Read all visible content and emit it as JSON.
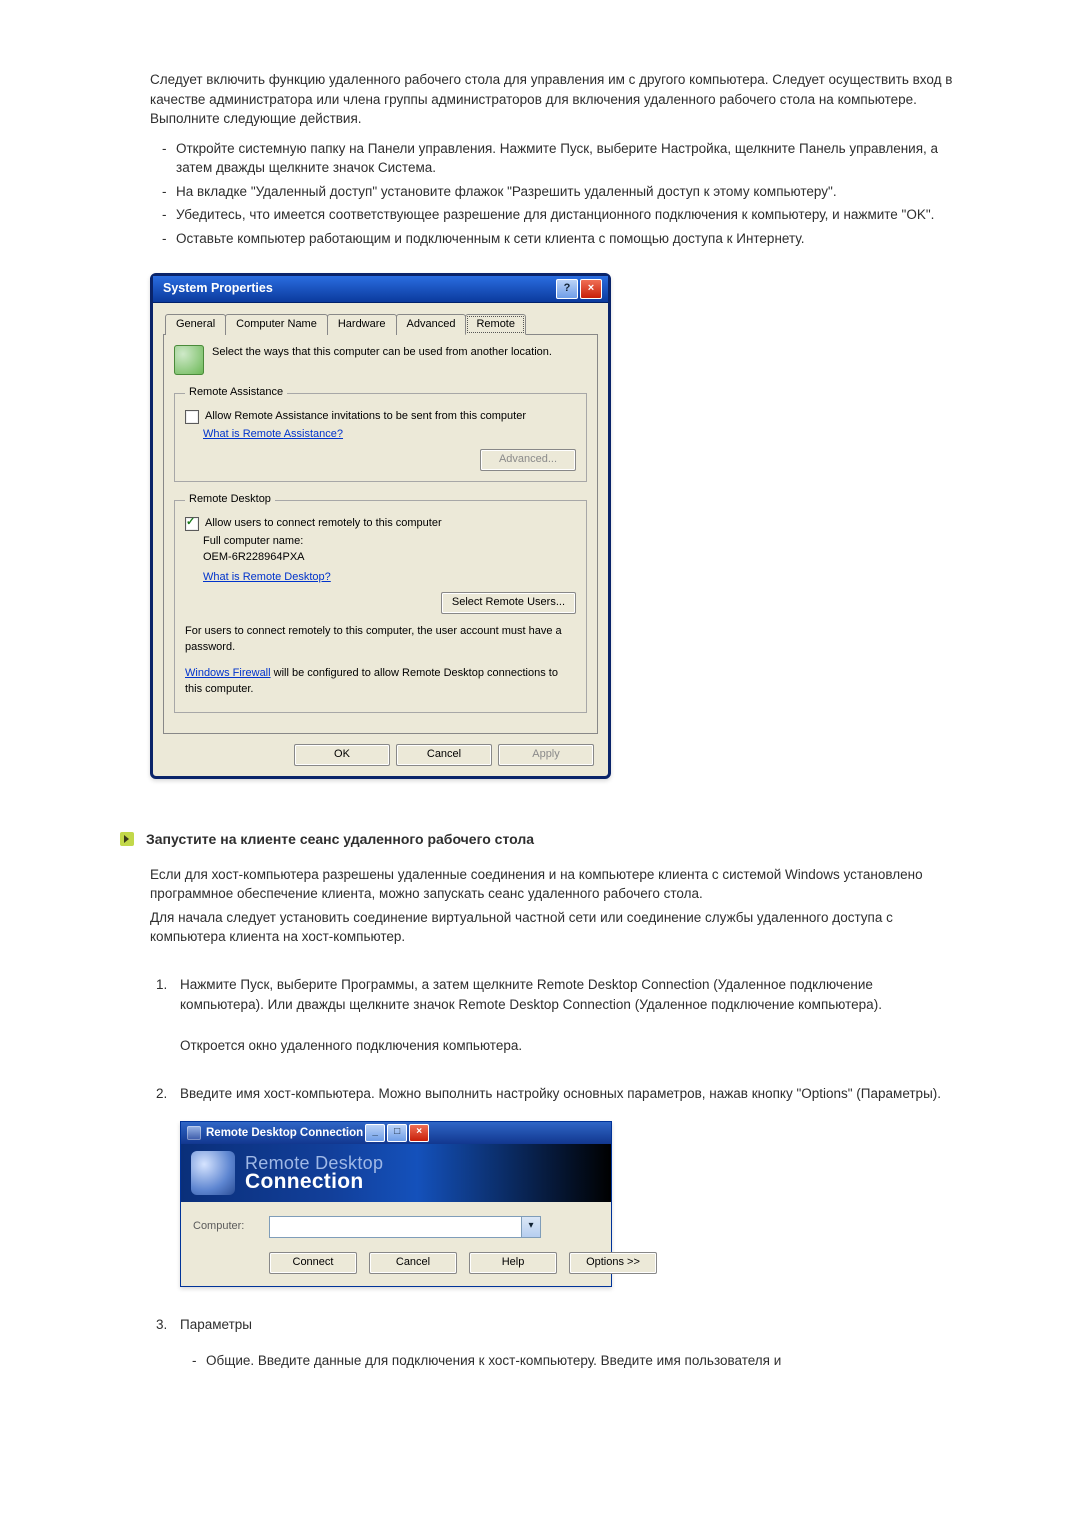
{
  "intro_p1": "Следует включить функцию удаленного рабочего стола для управления им с другого компьютера. Следует осуществить вход в качестве администратора или члена группы администраторов для включения удаленного рабочего стола на компьютере. Выполните следующие действия.",
  "intro_bullets": [
    "Откройте системную папку на Панели управления. Нажмите Пуск, выберите Настройка, щелкните Панель управления, а затем дважды щелкните значок Система.",
    "На вкладке \"Удаленный доступ\" установите флажок \"Разрешить удаленный доступ к этому компьютеру\".",
    "Убедитесь, что имеется соответствующее разрешение для дистанционного подключения к компьютеру, и нажмите \"OK\".",
    "Оставьте компьютер работающим и подключенным к сети клиента с помощью доступа к Интернету."
  ],
  "sys_dialog": {
    "title": "System Properties",
    "help_btn": "?",
    "close_btn": "×",
    "tabs": [
      "General",
      "Computer Name",
      "Hardware",
      "Advanced",
      "Remote"
    ],
    "active_tab": "Remote",
    "intro": "Select the ways that this computer can be used from another location.",
    "ra_legend": "Remote Assistance",
    "ra_checkbox": "Allow Remote Assistance invitations to be sent from this computer",
    "ra_link": "What is Remote Assistance?",
    "ra_advanced": "Advanced...",
    "rd_legend": "Remote Desktop",
    "rd_checkbox": "Allow users to connect remotely to this computer",
    "rd_fullname_label": "Full computer name:",
    "rd_fullname_value": "OEM-6R228964PXA",
    "rd_link": "What is Remote Desktop?",
    "rd_select_users": "Select Remote Users...",
    "rd_note": "For users to connect remotely to this computer, the user account must have a password.",
    "rd_firewall_link": "Windows Firewall",
    "rd_firewall_tail": " will be configured to allow Remote Desktop connections to this computer.",
    "ok": "OK",
    "cancel": "Cancel",
    "apply": "Apply"
  },
  "section2_title": "Запустите на клиенте сеанс удаленного рабочего стола",
  "section2_p1": "Если для хост-компьютера разрешены удаленные соединения и на компьютере клиента с системой Windows установлено программное обеспечение клиента, можно запускать сеанс удаленного рабочего стола.",
  "section2_p2": "Для начала следует установить соединение виртуальной частной сети или соединение службы удаленного доступа с компьютера клиента на хост-компьютер.",
  "steps": [
    {
      "num": "1.",
      "text": "Нажмите Пуск, выберите Программы, а затем щелкните Remote Desktop Connection (Удаленное подключение компьютера). Или дважды щелкните значок Remote Desktop Connection (Удаленное подключение компьютера).",
      "after": "Откроется окно удаленного подключения компьютера."
    },
    {
      "num": "2.",
      "text": "Введите имя хост-компьютера. Можно выполнить настройку основных параметров, нажав кнопку \"Options\" (Параметры)."
    },
    {
      "num": "3.",
      "text": "Параметры",
      "sub": "Общие. Введите данные для подключения к хост-компьютеру. Введите имя пользователя и"
    }
  ],
  "rdc_dialog": {
    "title": "Remote Desktop Connection",
    "min": "_",
    "max": "□",
    "close": "×",
    "header_line1": "Remote Desktop",
    "header_line2": "Connection",
    "computer_label": "Computer:",
    "computer_value": "",
    "connect": "Connect",
    "cancel": "Cancel",
    "help": "Help",
    "options": "Options >>"
  }
}
